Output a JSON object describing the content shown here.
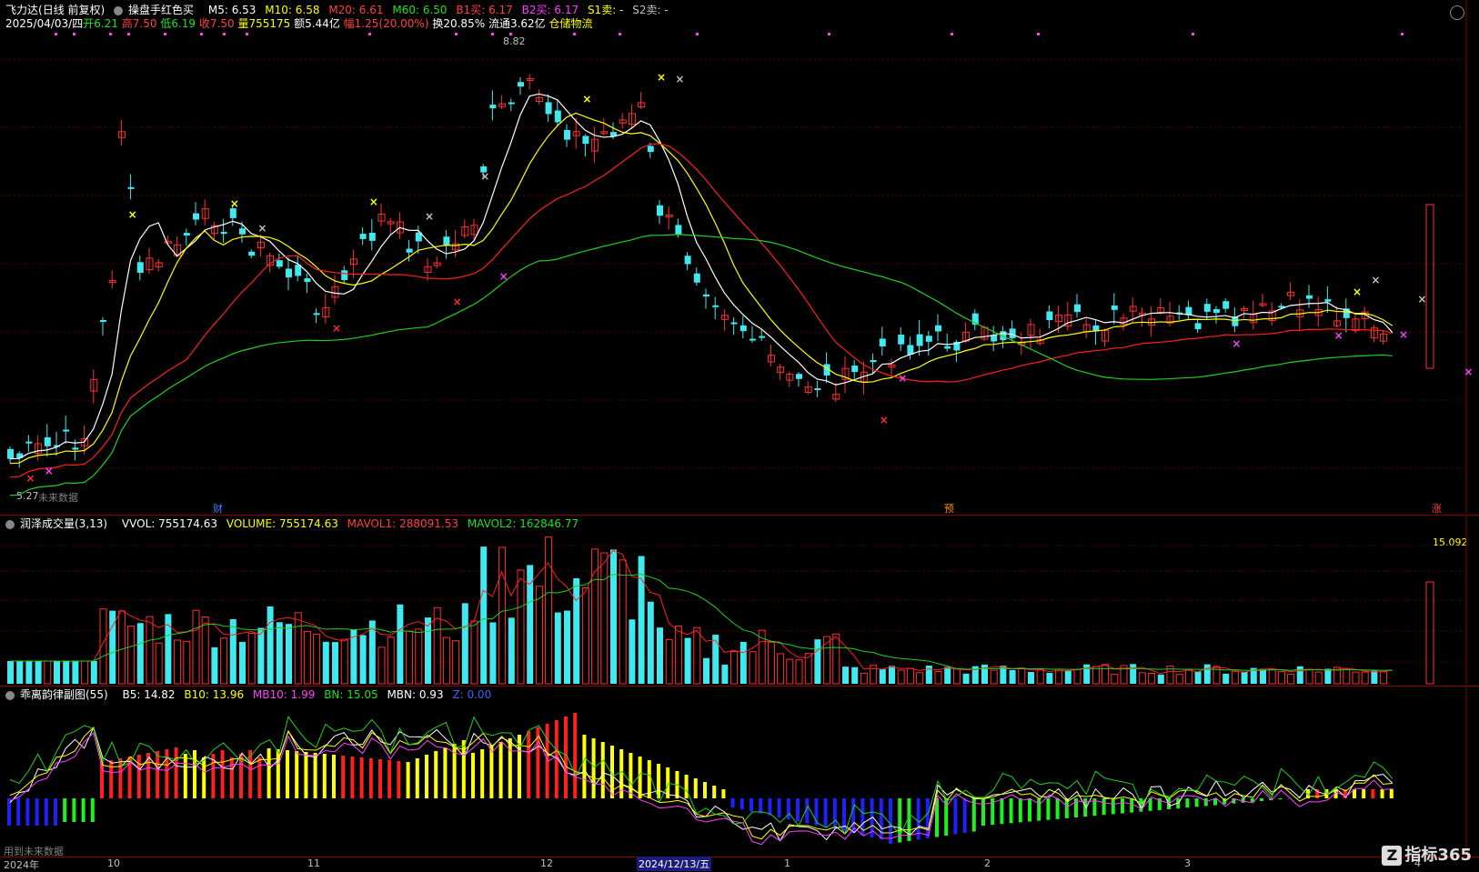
{
  "main": {
    "stock_name": "飞力达",
    "period": "(日线 前复权)",
    "indicator": "操盘手红色买",
    "ma": [
      {
        "label": "M5: 6.53",
        "color": "#ffffff"
      },
      {
        "label": "M10: 6.58",
        "color": "#ffff00"
      },
      {
        "label": "M20: 6.61",
        "color": "#ff4040"
      },
      {
        "label": "M60: 6.50",
        "color": "#20e020"
      }
    ],
    "signals": [
      {
        "label": "B1买: 6.17",
        "color": "#ff4040"
      },
      {
        "label": "B2买: 6.17",
        "color": "#ff40ff"
      },
      {
        "label": "S1卖: -",
        "color": "#ffff00"
      },
      {
        "label": "S2卖: -",
        "color": "#c0c0c0"
      }
    ],
    "info_date": "2025/04/03/四",
    "info_open": "开6.21",
    "info_high": "高7.50",
    "info_low": "低6.19",
    "info_close": "收7.50",
    "info_vol": "量755175",
    "info_amt": "额5.44亿",
    "info_pct": "幅1.25(20.00%)",
    "info_turn": "换20.85%",
    "info_float": "流通3.62亿",
    "info_tag": "仓储物流",
    "high_label": "8.82",
    "low_label": "5.27",
    "future_note": "未来数据",
    "event_markers": [
      {
        "label": "财",
        "color": "#4080ff"
      },
      {
        "label": "预",
        "color": "#ff8c00"
      },
      {
        "label": "涨",
        "color": "#ff4040"
      }
    ]
  },
  "volume_pane": {
    "name": "润泽成交量(3,13)",
    "vvol": "VVOL: 755174.63",
    "volume": "VOLUME: 755174.63",
    "mavol1": "MAVOL1: 288091.53",
    "mavol2": "MAVOL2: 162846.77",
    "right_value": "15.092"
  },
  "osc_pane": {
    "name": "乖离韵律副图(55)",
    "b5": "B5: 14.82",
    "b10": "B10: 13.96",
    "mb10": "MB10: 1.99",
    "bn": "BN: 15.05",
    "mbn": "MBN: 0.93",
    "z": "Z: 0.00",
    "bottom_note": "用到未来数据"
  },
  "time_axis": {
    "labels": [
      "2024年",
      "10",
      "11",
      "12",
      "2024/12/13/五",
      "1",
      "2",
      "3",
      "4"
    ]
  },
  "brand": {
    "logo_char": "Z",
    "name": "指标365"
  }
}
